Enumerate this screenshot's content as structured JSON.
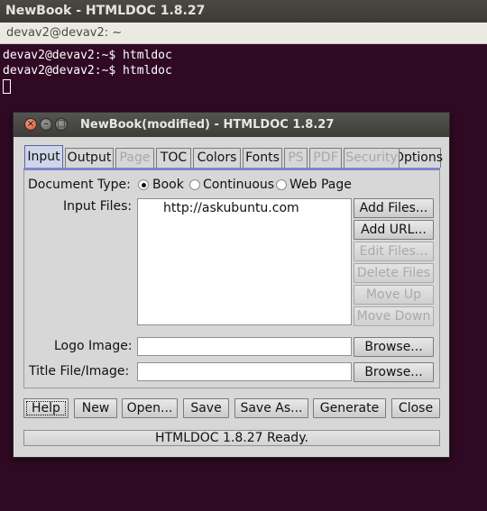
{
  "window": {
    "title": "NewBook - HTMLDOC 1.8.27"
  },
  "terminal": {
    "header": "devav2@devav2: ~",
    "lines": [
      "devav2@devav2:~$ htmldoc",
      "devav2@devav2:~$ htmldoc"
    ]
  },
  "dialog": {
    "title": "NewBook(modified) - HTMLDOC 1.8.27",
    "window_buttons": {
      "close": "×",
      "minimize": "–",
      "maximize": "□"
    },
    "tabs": [
      {
        "label": "Input",
        "active": true,
        "enabled": true
      },
      {
        "label": "Output",
        "active": false,
        "enabled": true
      },
      {
        "label": "Page",
        "active": false,
        "enabled": false
      },
      {
        "label": "TOC",
        "active": false,
        "enabled": true
      },
      {
        "label": "Colors",
        "active": false,
        "enabled": true
      },
      {
        "label": "Fonts",
        "active": false,
        "enabled": true
      },
      {
        "label": "PS",
        "active": false,
        "enabled": false
      },
      {
        "label": "PDF",
        "active": false,
        "enabled": false
      },
      {
        "label": "Security",
        "active": false,
        "enabled": false
      },
      {
        "label": "Options",
        "active": false,
        "enabled": true
      }
    ],
    "document_type": {
      "label": "Document Type:",
      "options": [
        "Book",
        "Continuous",
        "Web Page"
      ],
      "selected": "Book"
    },
    "input_files": {
      "label": "Input Files:",
      "items": [
        "http://askubuntu.com"
      ],
      "buttons": {
        "add_files": "Add Files...",
        "add_url": "Add URL...",
        "edit_files": "Edit Files...",
        "delete_files": "Delete Files",
        "move_up": "Move Up",
        "move_down": "Move Down"
      }
    },
    "logo_image": {
      "label": "Logo Image:",
      "value": "",
      "browse": "Browse..."
    },
    "title_file": {
      "label": "Title File/Image:",
      "value": "",
      "browse": "Browse..."
    },
    "bottom_buttons": {
      "help": "Help",
      "new": "New",
      "open": "Open...",
      "save": "Save",
      "save_as": "Save As...",
      "generate": "Generate",
      "close": "Close"
    },
    "status": "HTMLDOC 1.8.27 Ready."
  }
}
